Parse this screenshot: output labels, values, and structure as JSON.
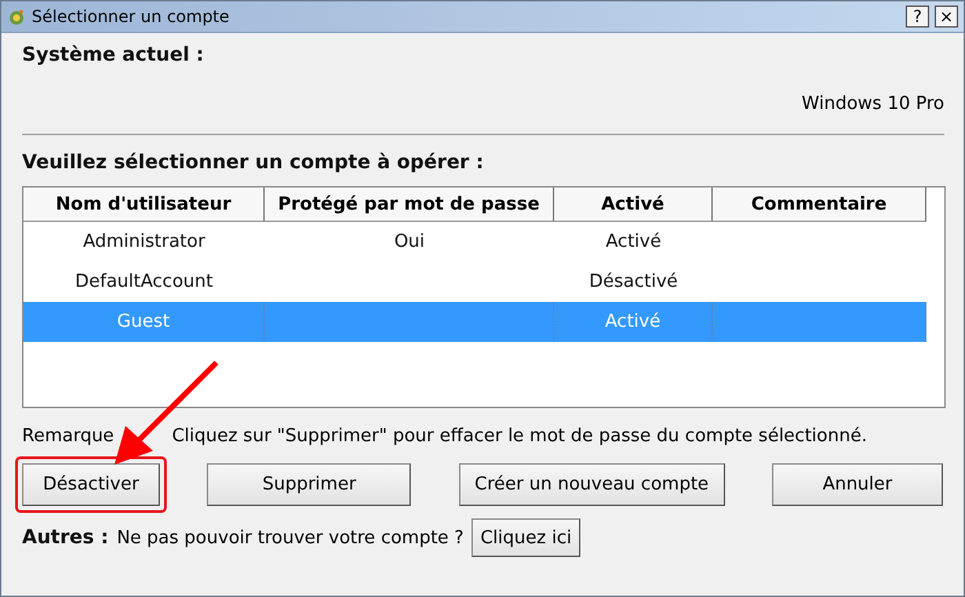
{
  "window": {
    "title": "Sélectionner un compte",
    "buttons": [
      "?",
      "×"
    ]
  },
  "system": {
    "label": "Système actuel :",
    "value": "Windows 10 Pro"
  },
  "prompt": "Veuillez sélectionner un compte à opérer :",
  "table": {
    "columns": [
      "Nom d'utilisateur",
      "Protégé par mot de passe",
      "Activé",
      "Commentaire"
    ],
    "rows": [
      {
        "cells": [
          "Administrator",
          "Oui",
          "Activé",
          ""
        ],
        "selected": false
      },
      {
        "cells": [
          "DefaultAccount",
          "",
          "Désactivé",
          ""
        ],
        "selected": false
      },
      {
        "cells": [
          "Guest",
          "",
          "Activé",
          ""
        ],
        "selected": true
      }
    ]
  },
  "remark": [
    "Remarque",
    "Cliquez sur \"Supprimer\" pour effacer le mot de passe du compte sélectionné."
  ],
  "buttons": [
    {
      "label": "Désactiver",
      "highlighted": true
    },
    {
      "label": "Supprimer",
      "highlighted": false
    },
    {
      "label": "Créer un nouveau compte",
      "highlighted": false
    },
    {
      "label": "Annuler",
      "highlighted": false
    }
  ],
  "others": {
    "label": "Autres :",
    "text": "Ne pas pouvoir trouver votre compte ?",
    "button": "Cliquez ici"
  }
}
